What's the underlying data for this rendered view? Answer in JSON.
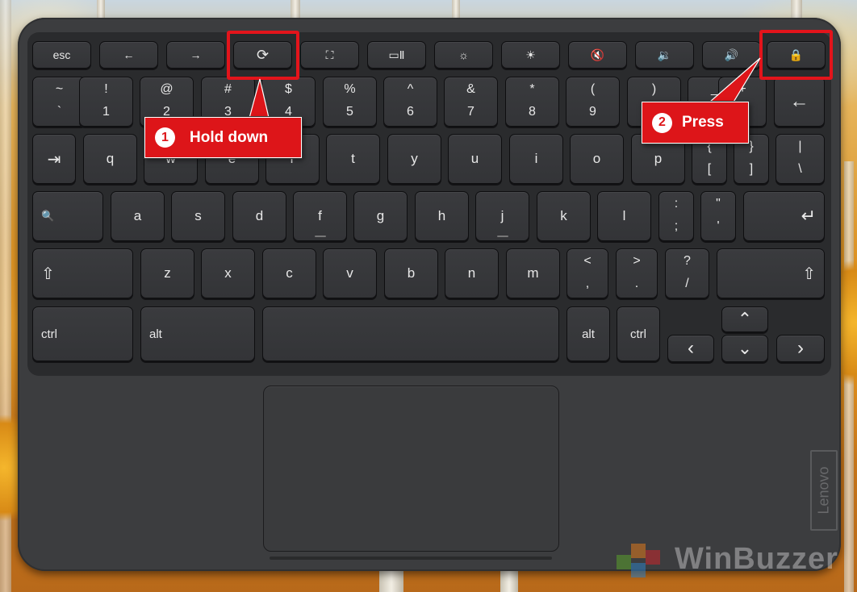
{
  "keyboard": {
    "row_function": [
      "esc",
      "←",
      "→",
      "⟳",
      "⛶",
      "▭Ⅱ",
      "☼",
      "☀",
      "🔇",
      "🔉",
      "🔊",
      "🔒"
    ],
    "row_numbers": [
      {
        "top": "~",
        "bot": "`"
      },
      {
        "top": "!",
        "bot": "1"
      },
      {
        "top": "@",
        "bot": "2"
      },
      {
        "top": "#",
        "bot": "3"
      },
      {
        "top": "$",
        "bot": "4"
      },
      {
        "top": "%",
        "bot": "5"
      },
      {
        "top": "^",
        "bot": "6"
      },
      {
        "top": "&",
        "bot": "7"
      },
      {
        "top": "*",
        "bot": "8"
      },
      {
        "top": "(",
        "bot": "9"
      },
      {
        "top": ")",
        "bot": "0"
      },
      {
        "top": "_",
        "bot": "-"
      },
      {
        "top": "+",
        "bot": "="
      },
      {
        "top": "",
        "bot": "←"
      }
    ],
    "row_qwerty": [
      "⇥",
      "q",
      "w",
      "e",
      "r",
      "t",
      "y",
      "u",
      "i",
      "o",
      "p"
    ],
    "row_qwerty_sym": [
      {
        "top": "{",
        "bot": "["
      },
      {
        "top": "}",
        "bot": "]"
      },
      {
        "top": "|",
        "bot": "\\"
      }
    ],
    "row_home": [
      "🔍",
      "a",
      "s",
      "d",
      "f",
      "g",
      "h",
      "j",
      "k",
      "l"
    ],
    "row_home_sym": [
      {
        "top": ":",
        "bot": ";"
      },
      {
        "top": "\"",
        "bot": "'"
      }
    ],
    "enter_label": "↵",
    "row_shift": [
      "⇧",
      "z",
      "x",
      "c",
      "v",
      "b",
      "n",
      "m"
    ],
    "row_shift_sym": [
      {
        "top": "<",
        "bot": ","
      },
      {
        "top": ">",
        "bot": "."
      },
      {
        "top": "?",
        "bot": "/"
      }
    ],
    "shift_right_label": "⇧",
    "row_bottom": {
      "ctrl_left": "ctrl",
      "alt_left": "alt",
      "alt_right": "alt",
      "ctrl_right": "ctrl"
    },
    "arrows": {
      "up": "⌃",
      "down": "⌄",
      "left": "‹",
      "right": "›"
    }
  },
  "brand": "Lenovo",
  "callouts": {
    "step1": {
      "number": "1",
      "label": "Hold down"
    },
    "step2": {
      "number": "2",
      "label": "Press"
    }
  },
  "watermark": "WinBuzzer",
  "colors": {
    "highlight": "#e3141b",
    "callout_bg": "#dd1519",
    "key_bg": "#353639"
  }
}
